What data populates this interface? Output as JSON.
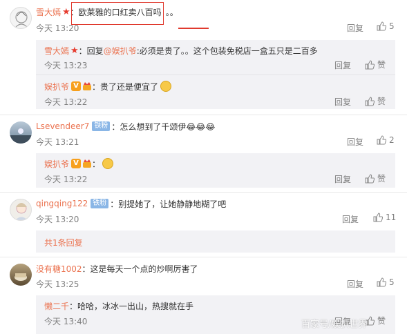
{
  "comments": [
    {
      "user": "雪大嫣",
      "text": "：欧莱雅的口红卖八百吗",
      "suffix": "。。",
      "time": "今天 13:20",
      "reply_label": "回复",
      "likes": "5"
    },
    {
      "user": "雪大嫣",
      "text": "：回复",
      "mention": "@娱扒爷",
      "text2": ":必须是贵了。。这个包装免税店一盒五只是二百多",
      "time": "今天 13:23",
      "reply_label": "回复",
      "likes": "赞"
    },
    {
      "user": "娱扒爷",
      "text": "：贵了还是便宜了",
      "time": "今天 13:22",
      "reply_label": "回复",
      "likes": "赞"
    },
    {
      "user": "Lsevendeer7",
      "badge": "铁粉",
      "text": "：怎么想到了千颂伊😂😂😂",
      "time": "今天 13:21",
      "reply_label": "回复",
      "likes": "2"
    },
    {
      "user": "娱扒爷",
      "text": "：",
      "time": "今天 13:22",
      "reply_label": "回复",
      "likes": "赞"
    },
    {
      "user": "qingqing122",
      "badge": "铁粉",
      "text": "：别提她了，让她静静地糊了吧",
      "time": "今天 13:20",
      "reply_label": "回复",
      "likes": "11"
    },
    {
      "more_replies": "共1条回复"
    },
    {
      "user": "没有糖1002",
      "text": "：这是每天一个点的炒啊厉害了",
      "time": "今天 13:25",
      "reply_label": "回复",
      "likes": "5"
    },
    {
      "user": "懒二千",
      "text": "：哈哈，冰冰一出山，热搜就在手",
      "time": "今天 13:40",
      "reply_label": "回复",
      "likes": "赞"
    }
  ],
  "watermark": "百家号/娱扒世界",
  "colors": {
    "username": "#eb7350",
    "highlight": "#e03a2e",
    "subbg": "#f2f2f5"
  }
}
